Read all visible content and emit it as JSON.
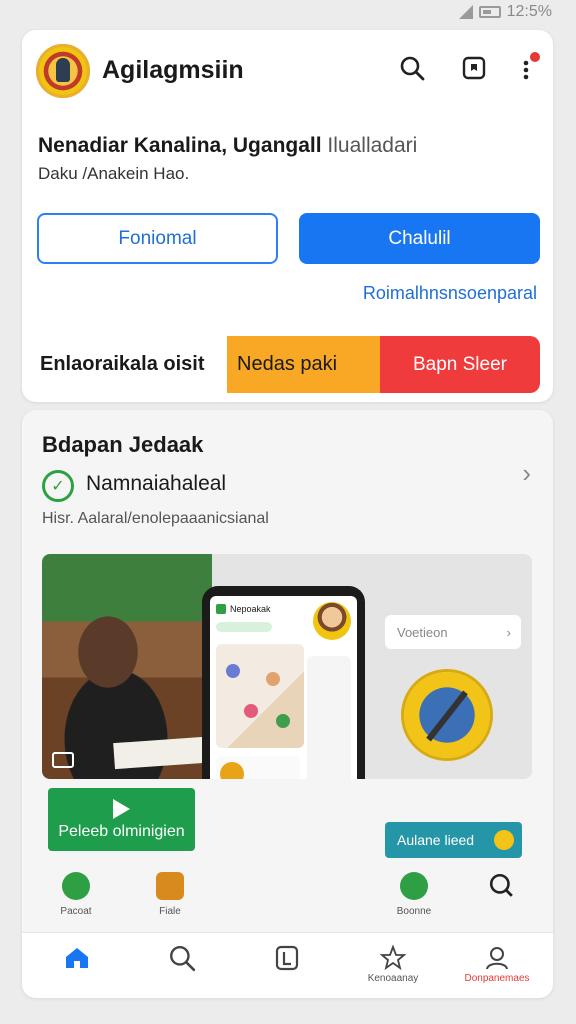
{
  "status": {
    "time": "12:5%"
  },
  "app": {
    "title": "Agilagmsiin"
  },
  "hero": {
    "heading_bold": "Nenadiar Kanalina, Ugangall",
    "heading_light": "Ilualladari",
    "subtitle": "Daku /Anakein Hao.",
    "btn_outline": "Foniomal",
    "btn_primary": "Chalulil",
    "link": "Roimalhnsnsoenparal"
  },
  "split_banner": {
    "left": "Enlaoraikala oisit",
    "middle": "Nedas paki",
    "right": "Bapn Sleer"
  },
  "section": {
    "title": "Bdapan Jedaak",
    "row_label": "Namnaiahaleal",
    "row_desc": "Hisr. Aalaral/enolepaaanicsianal",
    "chip": "Voetieon",
    "play_label": "Peleeb olminigien",
    "teal_label": "Aulane lieed"
  },
  "phone": {
    "header": "Nepoakak"
  },
  "mini_row": [
    {
      "label": "Pacoat",
      "icon": "leaf-icon"
    },
    {
      "label": "Fiale",
      "icon": "mountain-icon"
    },
    {
      "label": "Boonne",
      "icon": "leaf-icon"
    }
  ],
  "nav": [
    {
      "label": "",
      "icon": "home-icon"
    },
    {
      "label": "",
      "icon": "search-icon"
    },
    {
      "label": "",
      "icon": "document-icon"
    },
    {
      "label": "Kenoaanay",
      "icon": "star-icon"
    },
    {
      "label": "Donpanemaes",
      "icon": "person-icon"
    }
  ],
  "colors": {
    "primary": "#1976f2",
    "yellow": "#f9a825",
    "red": "#ef3b3b",
    "green": "#1e9d4c",
    "teal": "#2596a8"
  }
}
